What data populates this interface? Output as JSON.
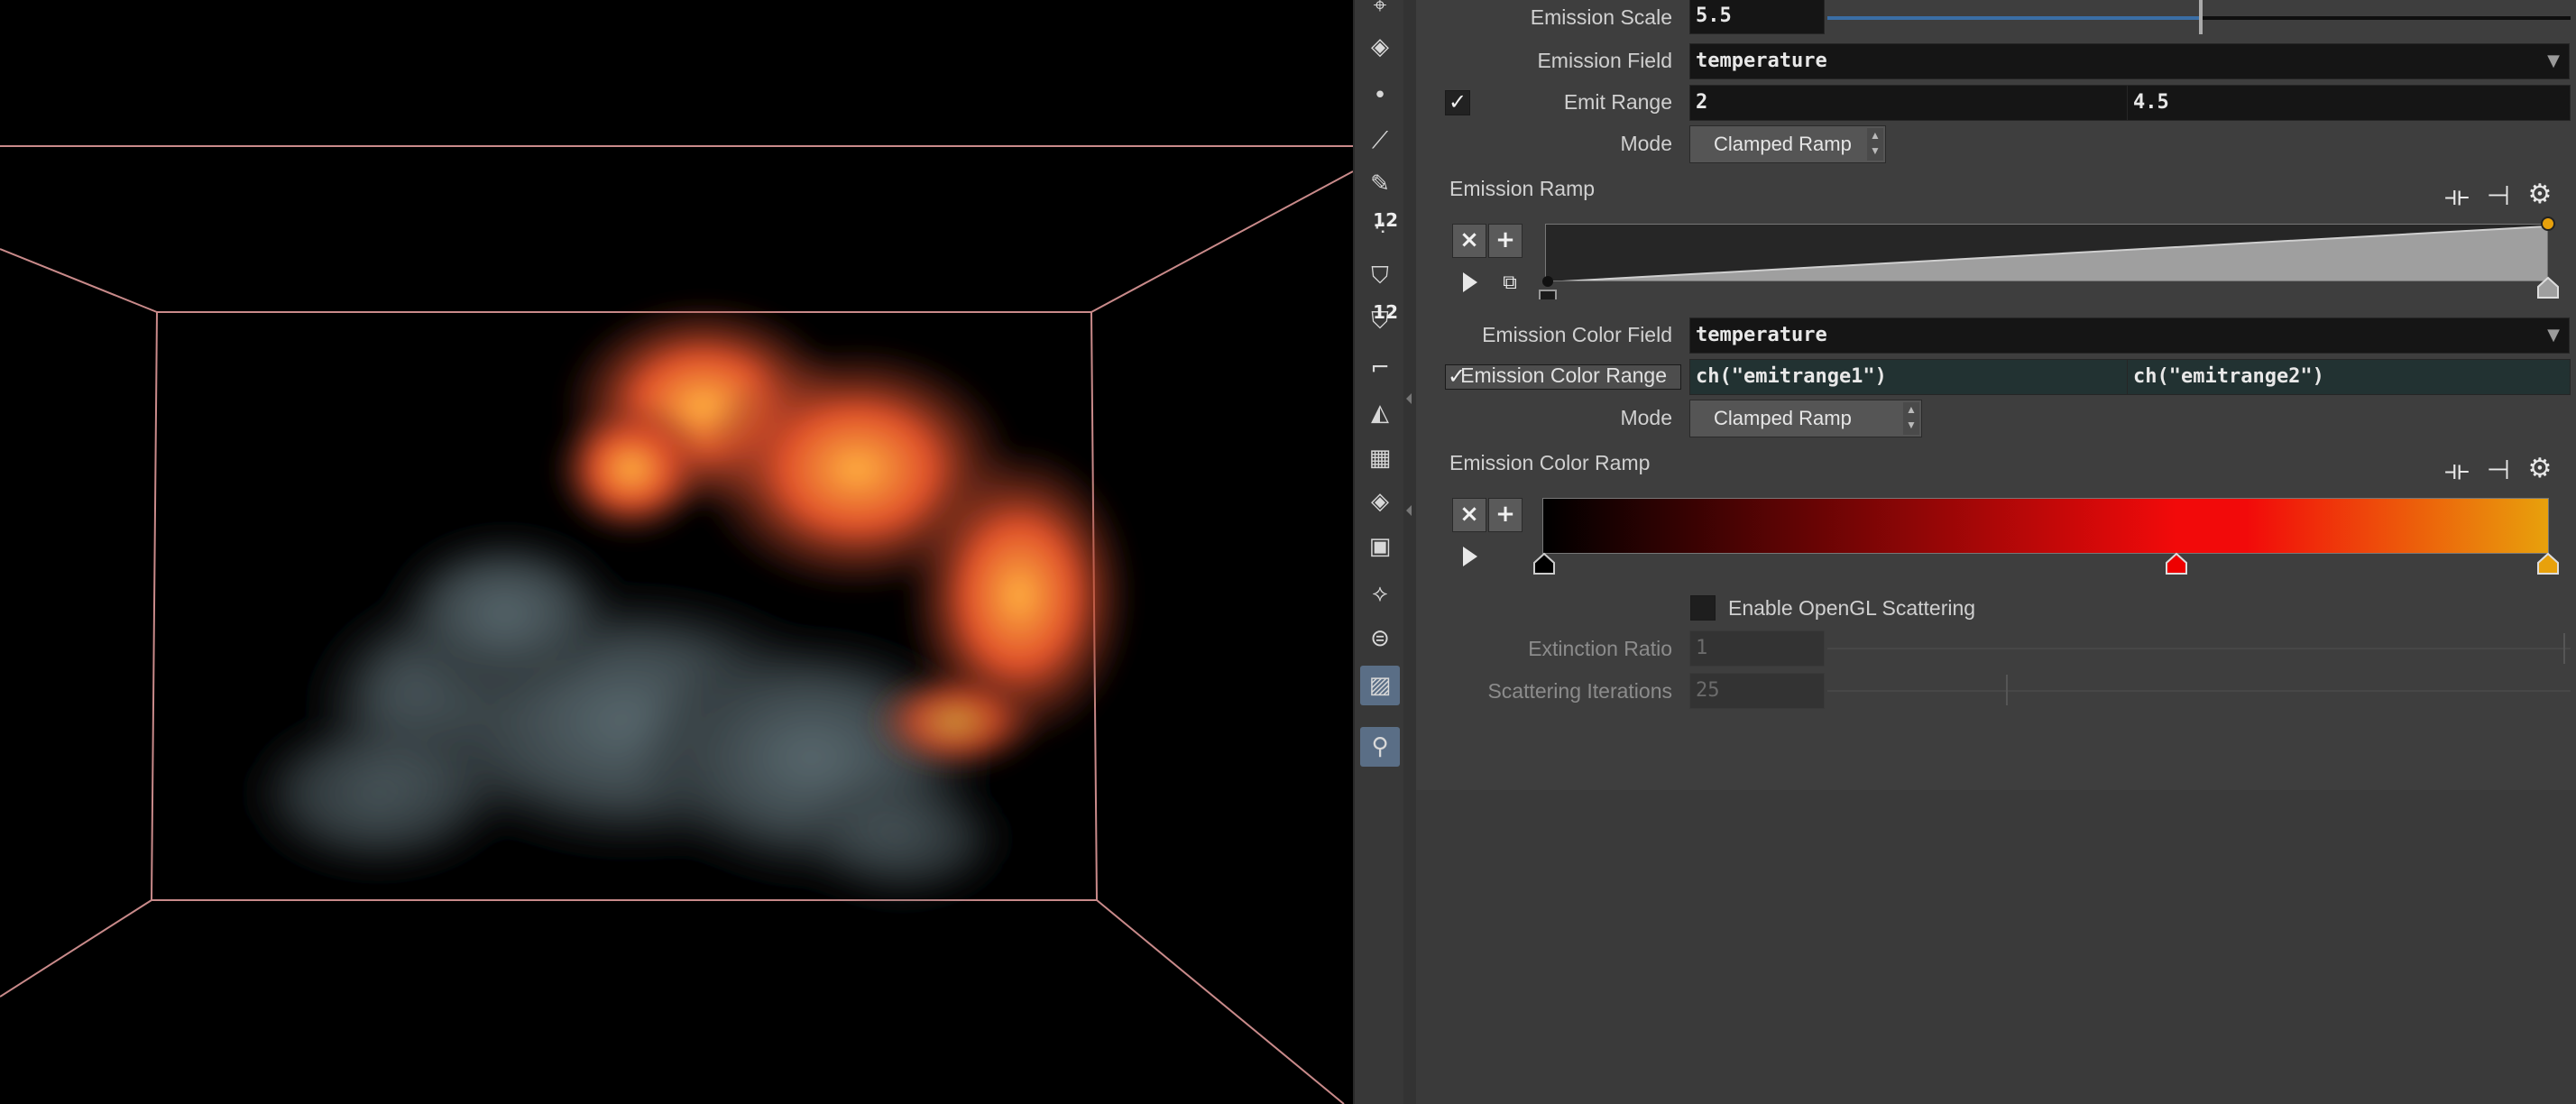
{
  "toolbar": {
    "icons": [
      "view-tools-icon",
      "camera-icon",
      "point-icon",
      "brush-icon",
      "pen-icon",
      "paint-12-icon",
      "bucket-icon",
      "bucket-12-icon",
      "curve-icon",
      "plane-icon",
      "checker-icon",
      "diamond-icon",
      "uv-icon",
      "handle-icon",
      "grid-icon",
      "background-image-icon",
      "pin-icon"
    ],
    "badge": "12"
  },
  "params": {
    "emission_scale": {
      "label": "Emission Scale",
      "value": "5.5",
      "slider_fraction": 0.5
    },
    "emission_field": {
      "label": "Emission Field",
      "value": "temperature"
    },
    "emit_range": {
      "label": "Emit Range",
      "enabled": true,
      "min": "2",
      "max": "4.5"
    },
    "mode1": {
      "label": "Mode",
      "value": "Clamped Ramp"
    },
    "emission_ramp": {
      "label": "Emission Ramp"
    },
    "emission_color_field": {
      "label": "Emission Color Field",
      "value": "temperature"
    },
    "emission_color_range": {
      "label": "Emission Color Range",
      "enabled": true,
      "min": "ch(\"emitrange1\")",
      "max": "ch(\"emitrange2\")"
    },
    "mode2": {
      "label": "Mode",
      "value": "Clamped Ramp"
    },
    "emission_color_ramp": {
      "label": "Emission Color Ramp",
      "colors": [
        "#000000",
        "#f20a0a",
        "#e8a10c"
      ]
    },
    "opengl_scattering": {
      "label": "Enable OpenGL Scattering",
      "enabled": false
    },
    "extinction_ratio": {
      "label": "Extinction Ratio",
      "value": "1"
    },
    "scattering_iterations": {
      "label": "Scattering Iterations",
      "value": "25"
    }
  },
  "ramp_buttons": {
    "remove": "×",
    "add": "+"
  }
}
